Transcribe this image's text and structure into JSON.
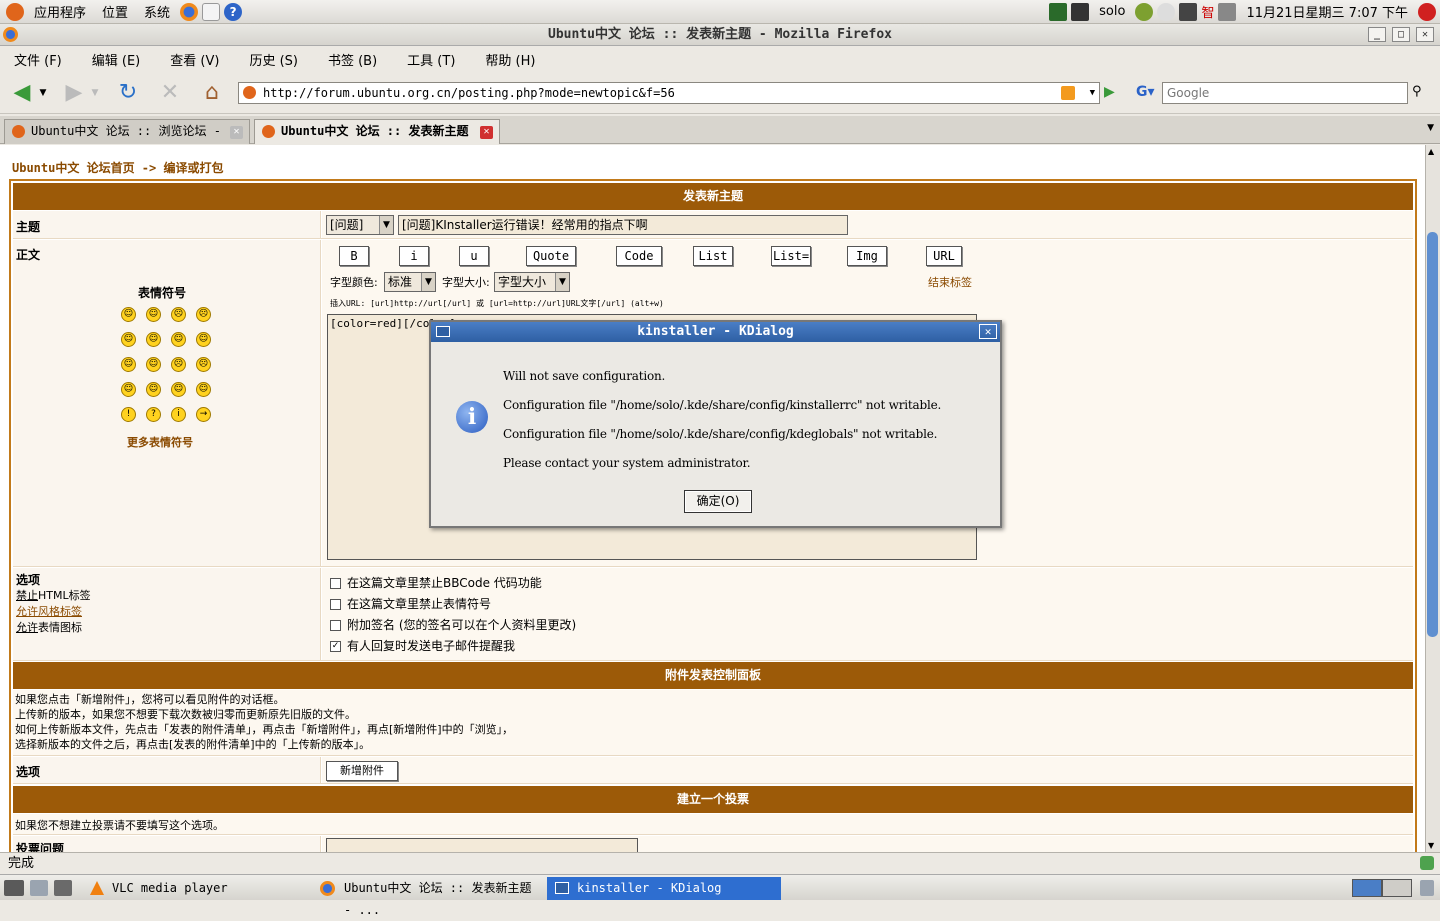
{
  "panel": {
    "apps": "应用程序",
    "places": "位置",
    "system": "系统",
    "user": "solo",
    "datetime": "11月21日星期三  7:07 下午",
    "im": "智"
  },
  "window": {
    "title": "Ubuntu中文 论坛 :: 发表新主题 - Mozilla Firefox"
  },
  "menu": [
    "文件 (F)",
    "编辑 (E)",
    "查看 (V)",
    "历史 (S)",
    "书签 (B)",
    "工具 (T)",
    "帮助 (H)"
  ],
  "nav": {
    "url": "http://forum.ubuntu.org.cn/posting.php?mode=newtopic&f=56",
    "search_placeholder": "Google"
  },
  "tabs": [
    {
      "label": "Ubuntu中文 论坛 :: 浏览论坛 - ..."
    },
    {
      "label": "Ubuntu中文 论坛 :: 发表新主题"
    }
  ],
  "breadcrumb": {
    "home": "Ubuntu中文 论坛首页",
    "sep": " -> ",
    "forum": "编译或打包"
  },
  "form": {
    "header": "发表新主题",
    "subject_label": "主题",
    "subject_type": "[问题]",
    "subject_value": "[问题]KInstaller运行错误！经常用的指点下啊",
    "body_label": "正文",
    "smilies_title": "表情符号",
    "more_smilies": "更多表情符号",
    "buttons": [
      "B",
      "i",
      "u",
      "Quote",
      "Code",
      "List",
      "List=",
      "Img",
      "URL"
    ],
    "font_color_label": "字型颜色:",
    "font_color": "标准",
    "font_size_label": "字型大小:",
    "font_size": "字型大小",
    "close_tags": "结束标签",
    "hint": "插入URL: [url]http://url[/url] 或 [url=http://url]URL文字[/url]  (alt+w)",
    "body_text": "[color=red][/color]",
    "options_label": "选项",
    "html_off": "禁止",
    "html_off2": "HTML标签",
    "bbcode_on": "允许",
    "bbcode_on2": "风格标签",
    "smilies_on": "允许",
    "smilies_on2": "表情图标",
    "opts": [
      {
        "label": "在这篇文章里禁止BBCode 代码功能",
        "checked": false
      },
      {
        "label": "在这篇文章里禁止表情符号",
        "checked": false
      },
      {
        "label": "附加签名 (您的签名可以在个人资料里更改)",
        "checked": false
      },
      {
        "label": "有人回复时发送电子邮件提醒我",
        "checked": true
      }
    ],
    "attach_header": "附件发表控制面板",
    "attach_text": [
      "如果您点击「新增附件」，您将可以看见附件的对话框。",
      "上传新的版本，如果您不想要下载次数被归零而更新原先旧版的文件。",
      "如何上传新版本文件，先点击「发表的附件清单」，再点击「新增附件」，再点[新增附件]中的「浏览」，",
      "选择新版本的文件之后，再点击[发表的附件清单]中的「上传新的版本」。"
    ],
    "attach_opt_label": "选项",
    "add_attach": "新增附件",
    "poll_header": "建立一个投票",
    "poll_hint": "如果您不想建立投票请不要填写这个选项。",
    "poll_q": "投票问题"
  },
  "dialog": {
    "title": "kinstaller - KDialog",
    "lines": [
      "Will not save configuration.",
      "Configuration file \"/home/solo/.kde/share/config/kinstallerrc\" not writable.",
      "Configuration file \"/home/solo/.kde/share/config/kdeglobals\" not writable.",
      "Please contact your system administrator."
    ],
    "ok": "确定(O)"
  },
  "status": "完成",
  "taskbar": [
    {
      "label": "VLC media player"
    },
    {
      "label": "Ubuntu中文 论坛 :: 发表新主题 - ..."
    },
    {
      "label": "kinstaller - KDialog"
    }
  ]
}
